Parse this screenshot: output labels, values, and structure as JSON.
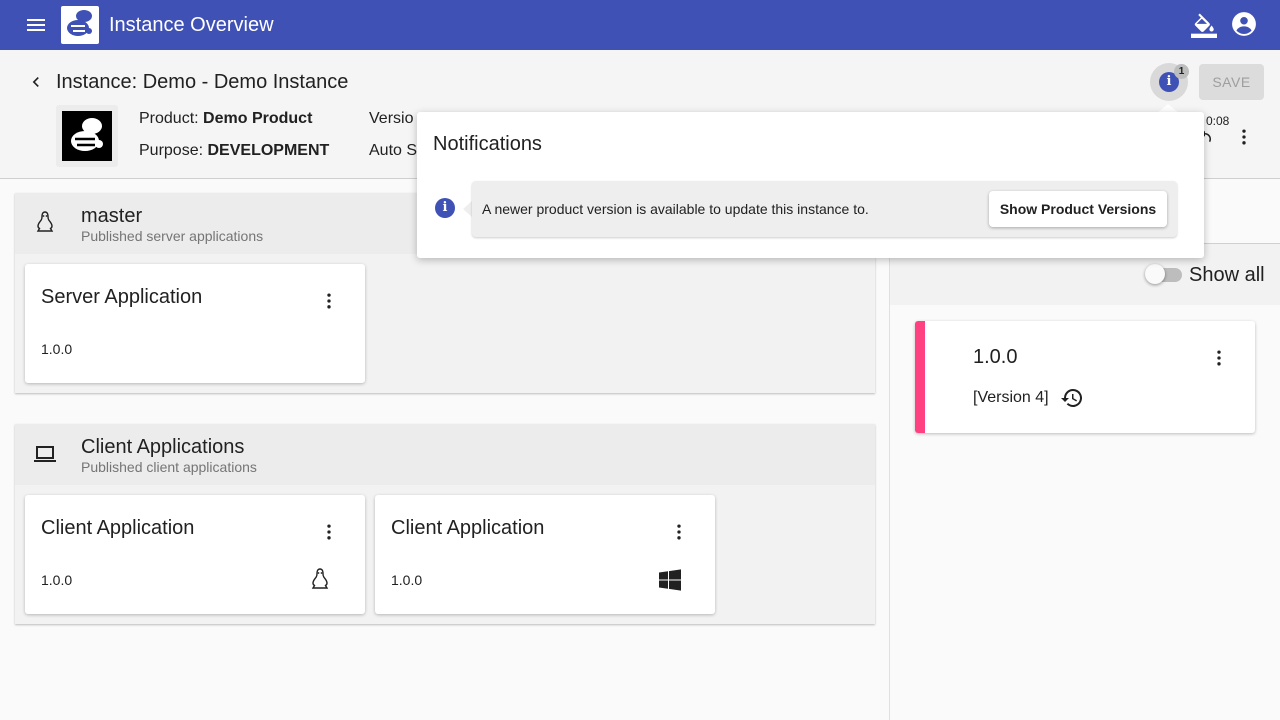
{
  "toolbar": {
    "title": "Instance Overview"
  },
  "header": {
    "title": "Instance: Demo - Demo Instance",
    "product_label": "Product:",
    "product_value": "Demo Product",
    "purpose_label": "Purpose:",
    "purpose_value": "DEVELOPMENT",
    "version_label": "Versio",
    "autostart_label": "Auto S",
    "notification_count": "1",
    "save_label": "SAVE",
    "time": "0:08"
  },
  "groups": [
    {
      "title": "master",
      "subtitle": "Published server applications",
      "icon": "linux-icon",
      "cards": [
        {
          "title": "Server Application",
          "version": "1.0.0"
        }
      ]
    },
    {
      "title": "Client Applications",
      "subtitle": "Published client applications",
      "icon": "laptop-icon",
      "cards": [
        {
          "title": "Client Application",
          "version": "1.0.0",
          "os_icon": "linux-icon"
        },
        {
          "title": "Client Application",
          "version": "1.0.0",
          "os_icon": "windows-icon"
        }
      ]
    }
  ],
  "right_panel": {
    "show_all_label": "Show all",
    "show_all_on": false,
    "version_card": {
      "version": "1.0.0",
      "tag": "[Version 4]",
      "accent": "#ff4081"
    }
  },
  "notifications": {
    "title": "Notifications",
    "message": "A newer product version is available to update this instance to.",
    "action_label": "Show Product Versions"
  },
  "colors": {
    "primary": "#3f51b5",
    "accent": "#ff4081"
  }
}
